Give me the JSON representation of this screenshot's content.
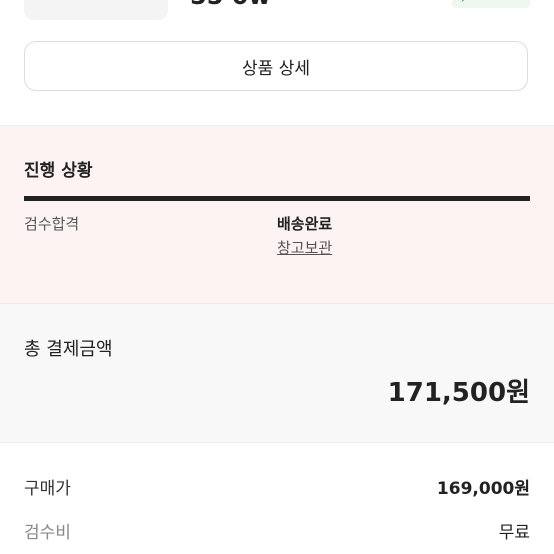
{
  "product": {
    "name_cut": "55 0w",
    "detail_button": "상품 상세"
  },
  "progress": {
    "title": "진행 상황",
    "steps": [
      {
        "label": "검수합격"
      },
      {
        "label": "배송완료",
        "sub": "창고보관"
      }
    ]
  },
  "total": {
    "label": "총 결제금액",
    "value": "171,500원"
  },
  "breakdown": [
    {
      "label": "구매가",
      "value": "169,000원"
    },
    {
      "label": "검수비",
      "value": "무료"
    }
  ],
  "colors": {
    "progress_bg": "#fdf3f3",
    "total_bg": "#f8f8f8",
    "badge_green": "#3fae6a"
  }
}
